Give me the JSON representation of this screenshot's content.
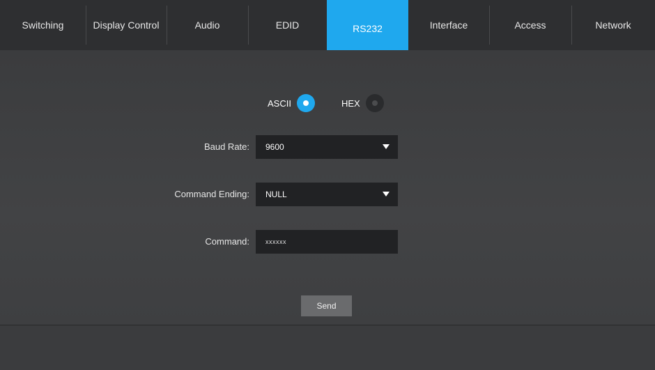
{
  "nav": {
    "tabs": [
      {
        "label": "Switching"
      },
      {
        "label": "Display Control"
      },
      {
        "label": "Audio"
      },
      {
        "label": "EDID"
      },
      {
        "label": "RS232"
      },
      {
        "label": "Interface"
      },
      {
        "label": "Access"
      },
      {
        "label": "Network"
      }
    ],
    "active_tab": "RS232",
    "accent_color": "#1fa8ee"
  },
  "rs232": {
    "mode": {
      "ascii_label": "ASCII",
      "hex_label": "HEX",
      "selected": "ASCII"
    },
    "baud_rate": {
      "label": "Baud Rate:",
      "value": "9600"
    },
    "command_ending": {
      "label": "Command Ending:",
      "value": "NULL"
    },
    "command": {
      "label": "Command:",
      "value": "xxxxxx"
    },
    "send_label": "Send"
  }
}
